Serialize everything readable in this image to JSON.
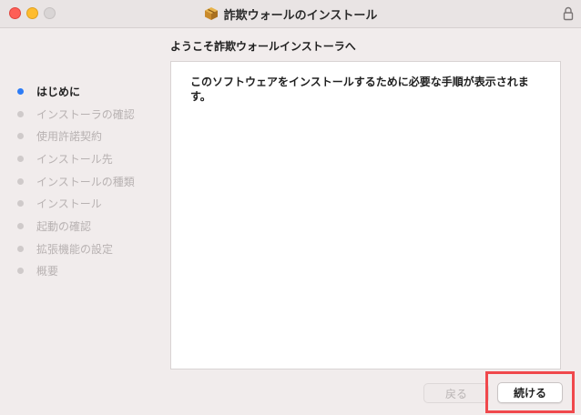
{
  "window": {
    "title": "詐欺ウォールのインストール"
  },
  "heading": "ようこそ詐欺ウォールインストーラへ",
  "sidebar": {
    "steps": [
      {
        "label": "はじめに",
        "active": true
      },
      {
        "label": "インストーラの確認",
        "active": false
      },
      {
        "label": "使用許諾契約",
        "active": false
      },
      {
        "label": "インストール先",
        "active": false
      },
      {
        "label": "インストールの種類",
        "active": false
      },
      {
        "label": "インストール",
        "active": false
      },
      {
        "label": "起動の確認",
        "active": false
      },
      {
        "label": "拡張機能の設定",
        "active": false
      },
      {
        "label": "概要",
        "active": false
      }
    ]
  },
  "content": {
    "text": "このソフトウェアをインストールするために必要な手順が表示されます。"
  },
  "buttons": {
    "back": "戻る",
    "continue": "続ける"
  },
  "colors": {
    "active_step_dot": "#2d7cf6",
    "highlight_border": "#f0484c"
  }
}
